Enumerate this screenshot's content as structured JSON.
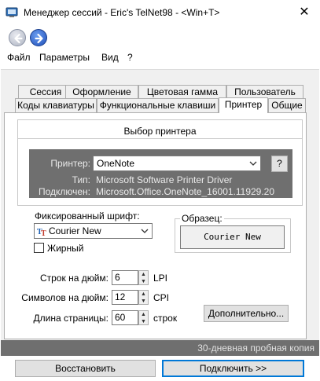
{
  "window": {
    "title": "Менеджер сессий - Eric's TelNet98 - <Win+T>",
    "close_glyph": "✕"
  },
  "menu": [
    "Файл",
    "Параметры",
    "Вид",
    "?"
  ],
  "tabs_row1": [
    "Сессия",
    "Оформление",
    "Цветовая гамма",
    "Пользователь"
  ],
  "tabs_row2": [
    "Коды клавиатуры",
    "Функциональные клавиши",
    "Принтер",
    "Общие"
  ],
  "active_tab": "Принтер",
  "printer_group": {
    "title": "Выбор принтера",
    "printer_label": "Принтер:",
    "printer_value": "OneNote",
    "help_label": "?",
    "type_label": "Тип:",
    "type_value": "Microsoft Software Printer Driver",
    "connected_label": "Подключен:",
    "connected_value": "Microsoft.Office.OneNote_16001.11929.20"
  },
  "font": {
    "label": "Фиксированный шрифт:",
    "value": "Courier New",
    "bold_label": "Жирный",
    "bold_checked": false,
    "sample_label": "Образец:",
    "sample_text": "Courier New"
  },
  "spinners": {
    "lines_label": "Строк на дюйм:",
    "lines_value": "6",
    "lines_unit": "LPI",
    "chars_label": "Символов на дюйм:",
    "chars_value": "12",
    "chars_unit": "CPI",
    "page_label": "Длина страницы:",
    "page_value": "60",
    "page_unit": "строк"
  },
  "buttons": {
    "advanced": "Дополнительно...",
    "restore": "Восстановить",
    "connect": "Подключить >>"
  },
  "trial_text": "30-дневная пробная копия",
  "icons": {
    "app": "terminal-app-icon",
    "back": "back-arrow-icon",
    "forward": "forward-arrow-icon",
    "dropdown": "chevron-down-icon",
    "font": "truetype-font-icon"
  },
  "colors": {
    "dark_panel": "#6f6f6f",
    "accent": "#0078d7"
  }
}
